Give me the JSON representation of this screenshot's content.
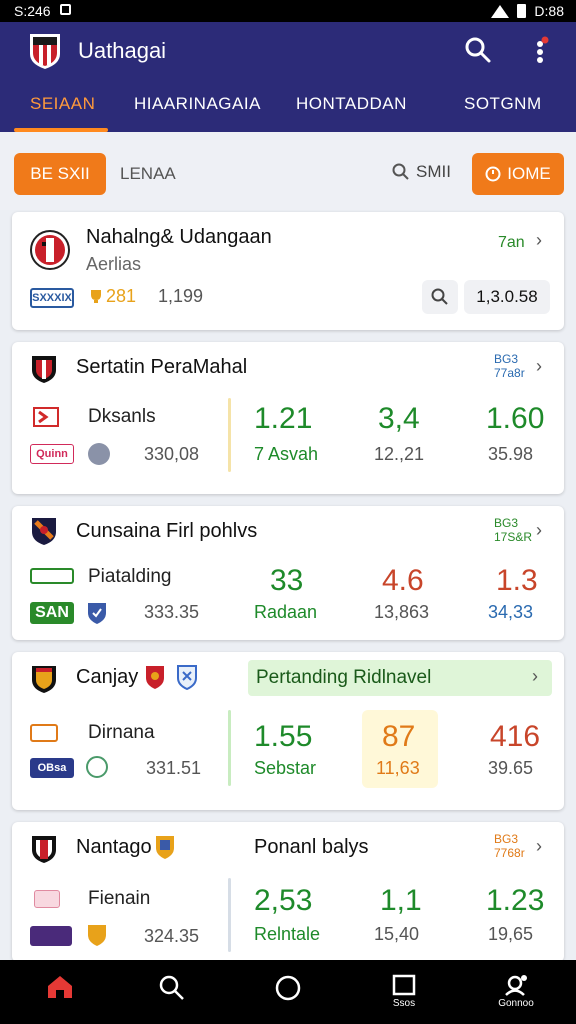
{
  "status": {
    "time": "S:246",
    "right_time": "D:88"
  },
  "app": {
    "title": "Uathagai"
  },
  "tabs": [
    {
      "label": "SEIAAN",
      "active": true
    },
    {
      "label": "HIAARINAGAIA",
      "active": false
    },
    {
      "label": "HONTADDAN",
      "active": false
    },
    {
      "label": "SOTGNM",
      "active": false
    }
  ],
  "filter": {
    "left_button": "BE SXII",
    "label": "LENAA",
    "search_label": "SMII",
    "right_button": "IOME"
  },
  "cards": [
    {
      "title": "Nahalng& Udangaan",
      "subtitle": "Aerlias",
      "time": "7an",
      "chip": "SXXXIX",
      "score": "281",
      "count": "1,199",
      "value_box": "1,3.0.58"
    },
    {
      "title": "Sertatin PeraMahal",
      "corner": [
        "BG3",
        "77a8r"
      ],
      "team_name": "Dksanls",
      "chip": "Quinn",
      "count": "330,08",
      "odds": [
        {
          "value": "1.21",
          "sub": "7 Asvah"
        },
        {
          "value": "3,4",
          "sub": "12.,21"
        },
        {
          "value": "1.60",
          "sub": "35.98"
        }
      ]
    },
    {
      "title": "Cunsaina Firl pohlvs",
      "corner": [
        "BG3",
        "17S&R"
      ],
      "team_name": "Piatalding",
      "chip_top": "",
      "chip": "SAN",
      "count": "333.35",
      "odds": [
        {
          "value": "33",
          "sub": "Radaan"
        },
        {
          "value": "4.6",
          "sub": "13,863"
        },
        {
          "value": "1.3",
          "sub": "34,33"
        }
      ]
    },
    {
      "title": "Canjay",
      "banner": "Pertanding Ridlnavel",
      "team_name": "Dirnana",
      "chip": "OBsa",
      "count": "331.51",
      "odds": [
        {
          "value": "1.55",
          "sub": "Sebstar"
        },
        {
          "value": "87",
          "sub": "11,63"
        },
        {
          "value": "416",
          "sub": "39.65"
        }
      ]
    },
    {
      "title": "Nantago",
      "title2": "Ponanl balys",
      "corner": [
        "BG3",
        "7768r"
      ],
      "team_name": "Fienain",
      "chip": "",
      "count": "324.35",
      "odds": [
        {
          "value": "2,53",
          "sub": "Relntale"
        },
        {
          "value": "1,1",
          "sub": "15,40"
        },
        {
          "value": "1.23",
          "sub": "19,65"
        }
      ]
    }
  ],
  "nav": [
    {
      "label": ""
    },
    {
      "label": ""
    },
    {
      "label": ""
    },
    {
      "label": "Ssos"
    },
    {
      "label": "Gonnoo"
    }
  ],
  "colors": {
    "appbar": "#2c2b78",
    "accent": "#f07a1a",
    "green": "#1e8a2a",
    "red": "#c8452a"
  }
}
